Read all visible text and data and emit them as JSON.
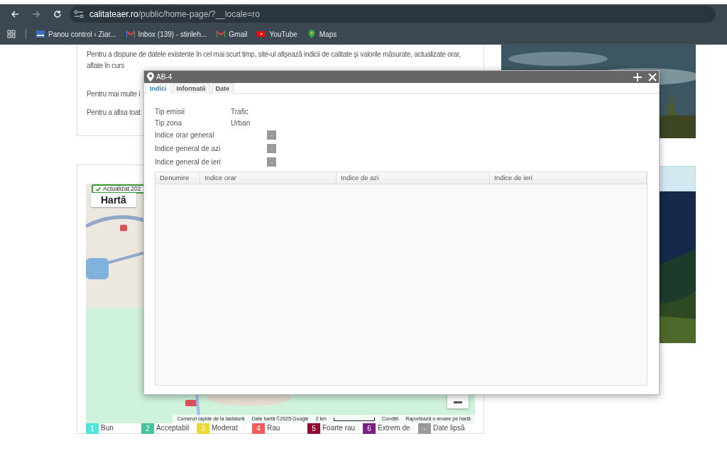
{
  "browser": {
    "url_host": "calitateaer.ro",
    "url_path": "/public/home-page/?__locale=ro",
    "bookmarks": [
      {
        "kind": "site",
        "label": "Panou control ‹ Ziar..."
      },
      {
        "kind": "mail",
        "label": "Inbox (139) - stirileh..."
      },
      {
        "kind": "mail",
        "label": "Gmail"
      },
      {
        "kind": "video",
        "label": "YouTube"
      },
      {
        "kind": "pin",
        "label": "Maps"
      }
    ]
  },
  "intro": {
    "paragraph": "Pentru a dispune de datele existente în cel mai scurt timp, site-ul afişează indicii de calitate şi valorile măsurate, actualizate orar, aflate în curs",
    "lines": [
      "Pentru mai multe i",
      "Pentru a afisa toat"
    ]
  },
  "map": {
    "updated": "Actualizat:202",
    "tab": "Hartă",
    "attribution": [
      "Comenzi rapide de la tastatură",
      "Date hartă ©2025 Google",
      "2 km",
      "Condiții",
      "Raportează o eroare pe hartă"
    ]
  },
  "legend": [
    {
      "number": "1",
      "label": "Bun",
      "color": "#4ee6dc"
    },
    {
      "number": "2",
      "label": "Acceptabil",
      "color": "#46c29e"
    },
    {
      "number": "3",
      "label": "Moderat",
      "color": "#ecd935"
    },
    {
      "number": "4",
      "label": "Rau",
      "color": "#f55b5b"
    },
    {
      "number": "5",
      "label": "Foarte rau",
      "color": "#8e0b2f"
    },
    {
      "number": "6",
      "label": "Extrem de",
      "color": "#7b1f86"
    },
    {
      "number": "-",
      "label": "Date lipsă",
      "color": "#999999"
    }
  ],
  "dialog": {
    "title": "AB-4",
    "tabs": [
      {
        "label": "Indici",
        "selected": true
      },
      {
        "label": "Informatii",
        "selected": false
      },
      {
        "label": "Date",
        "selected": false
      }
    ],
    "info": [
      {
        "kind": "text",
        "label": "Tip emisii",
        "value": "Trafic"
      },
      {
        "kind": "text",
        "label": "Tip zona",
        "value": "Urban"
      },
      {
        "kind": "badge",
        "label": "Indice orar general",
        "value": "-"
      },
      {
        "kind": "badge",
        "label": "Indice general de azi",
        "value": "-"
      },
      {
        "kind": "badge",
        "label": "Indice general de ieri",
        "value": "-"
      }
    ],
    "table": {
      "columns": [
        "Denumire",
        "Indice orar",
        "Indice de azi",
        "Indice de ieri"
      ]
    }
  }
}
